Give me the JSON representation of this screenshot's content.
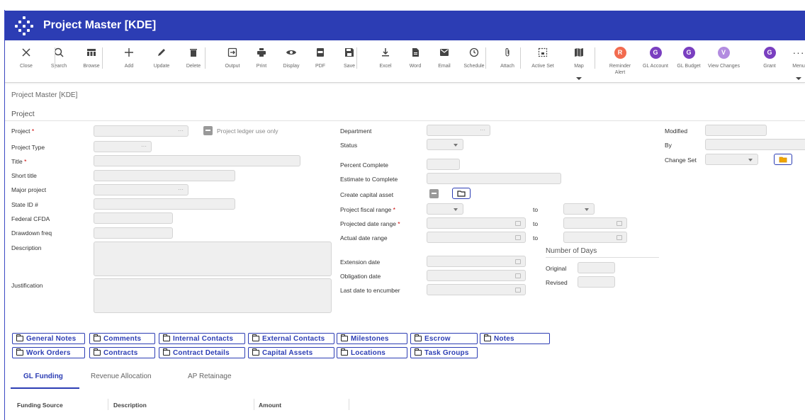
{
  "window": {
    "title": "Project Master [KDE]"
  },
  "toolbar": [
    {
      "key": "close",
      "label": "Close",
      "icon": "close-icon"
    },
    {
      "key": "search",
      "label": "Search",
      "icon": "search-icon"
    },
    {
      "key": "browse",
      "label": "Browse",
      "icon": "browse-icon"
    },
    {
      "key": "add",
      "label": "Add",
      "icon": "plus-icon"
    },
    {
      "key": "update",
      "label": "Update",
      "icon": "pencil-icon"
    },
    {
      "key": "delete",
      "label": "Delete",
      "icon": "trash-icon"
    },
    {
      "key": "output",
      "label": "Output",
      "icon": "output-icon"
    },
    {
      "key": "print",
      "label": "Print",
      "icon": "printer-icon"
    },
    {
      "key": "display",
      "label": "Display",
      "icon": "eye-icon"
    },
    {
      "key": "pdf",
      "label": "PDF",
      "icon": "pdf-icon"
    },
    {
      "key": "save",
      "label": "Save",
      "icon": "save-icon"
    },
    {
      "key": "excel",
      "label": "Excel",
      "icon": "download-icon"
    },
    {
      "key": "word",
      "label": "Word",
      "icon": "document-icon"
    },
    {
      "key": "email",
      "label": "Email",
      "icon": "envelope-icon"
    },
    {
      "key": "schedule",
      "label": "Schedule",
      "icon": "clock-icon"
    },
    {
      "key": "attach",
      "label": "Attach",
      "icon": "paperclip-icon"
    },
    {
      "key": "activeset",
      "label": "Active Set",
      "icon": "active-set-icon"
    },
    {
      "key": "map",
      "label": "Map",
      "icon": "map-icon"
    },
    {
      "key": "reminder",
      "label": "Reminder Alert",
      "icon": "reminder-icon",
      "letter": "R",
      "color": "#f26b4f"
    },
    {
      "key": "glaccount",
      "label": "GL Account",
      "icon": "gl-account-icon",
      "letter": "G",
      "color": "#7a3fc0"
    },
    {
      "key": "glbudget",
      "label": "GL Budget",
      "icon": "gl-budget-icon",
      "letter": "G",
      "color": "#7a3fc0"
    },
    {
      "key": "viewchanges",
      "label": "View Changes",
      "icon": "view-changes-icon",
      "letter": "V",
      "color": "#b38ce0"
    },
    {
      "key": "grant",
      "label": "Grant",
      "icon": "grant-icon",
      "letter": "G",
      "color": "#7a3fc0"
    },
    {
      "key": "menu",
      "label": "Menu",
      "icon": "ellipsis-icon"
    }
  ],
  "breadcrumb": "Project Master [KDE]",
  "section_title": "Project",
  "labels": {
    "project": "Project",
    "project_type": "Project Type",
    "title": "Title",
    "short_title": "Short title",
    "major_project": "Major project",
    "state_id": "State ID #",
    "federal_cfda": "Federal CFDA",
    "drawdown_freq": "Drawdown freq",
    "description": "Description",
    "justification": "Justification",
    "project_ledger": "Project ledger use only",
    "department": "Department",
    "status": "Status",
    "percent_complete": "Percent Complete",
    "estimate_to_complete": "Estimate to Complete",
    "create_capital_asset": "Create capital asset",
    "project_fiscal_range": "Project fiscal range",
    "projected_date_range": "Projected date range",
    "actual_date_range": "Actual date range",
    "to": "to",
    "extension_date": "Extension date",
    "obligation_date": "Obligation date",
    "last_date_to_encumber": "Last date to encumber",
    "number_of_days": "Number of Days",
    "original": "Original",
    "revised": "Revised",
    "modified": "Modified",
    "by": "By",
    "change_set": "Change Set",
    "required_mark": "*"
  },
  "links_row1": [
    "General Notes",
    "Comments",
    "Internal Contacts",
    "External Contacts",
    "Milestones",
    "Escrow",
    "Notes"
  ],
  "links_row2": [
    "Work Orders",
    "Contracts",
    "Contract Details",
    "Capital Assets",
    "Locations",
    "Task Groups"
  ],
  "tabs": [
    "GL Funding",
    "Revenue Allocation",
    "AP Retainage"
  ],
  "grid_columns": [
    "Funding Source",
    "Description",
    "Amount"
  ],
  "colors": {
    "brand": "#2c3db4",
    "folder": "#f0a500"
  }
}
